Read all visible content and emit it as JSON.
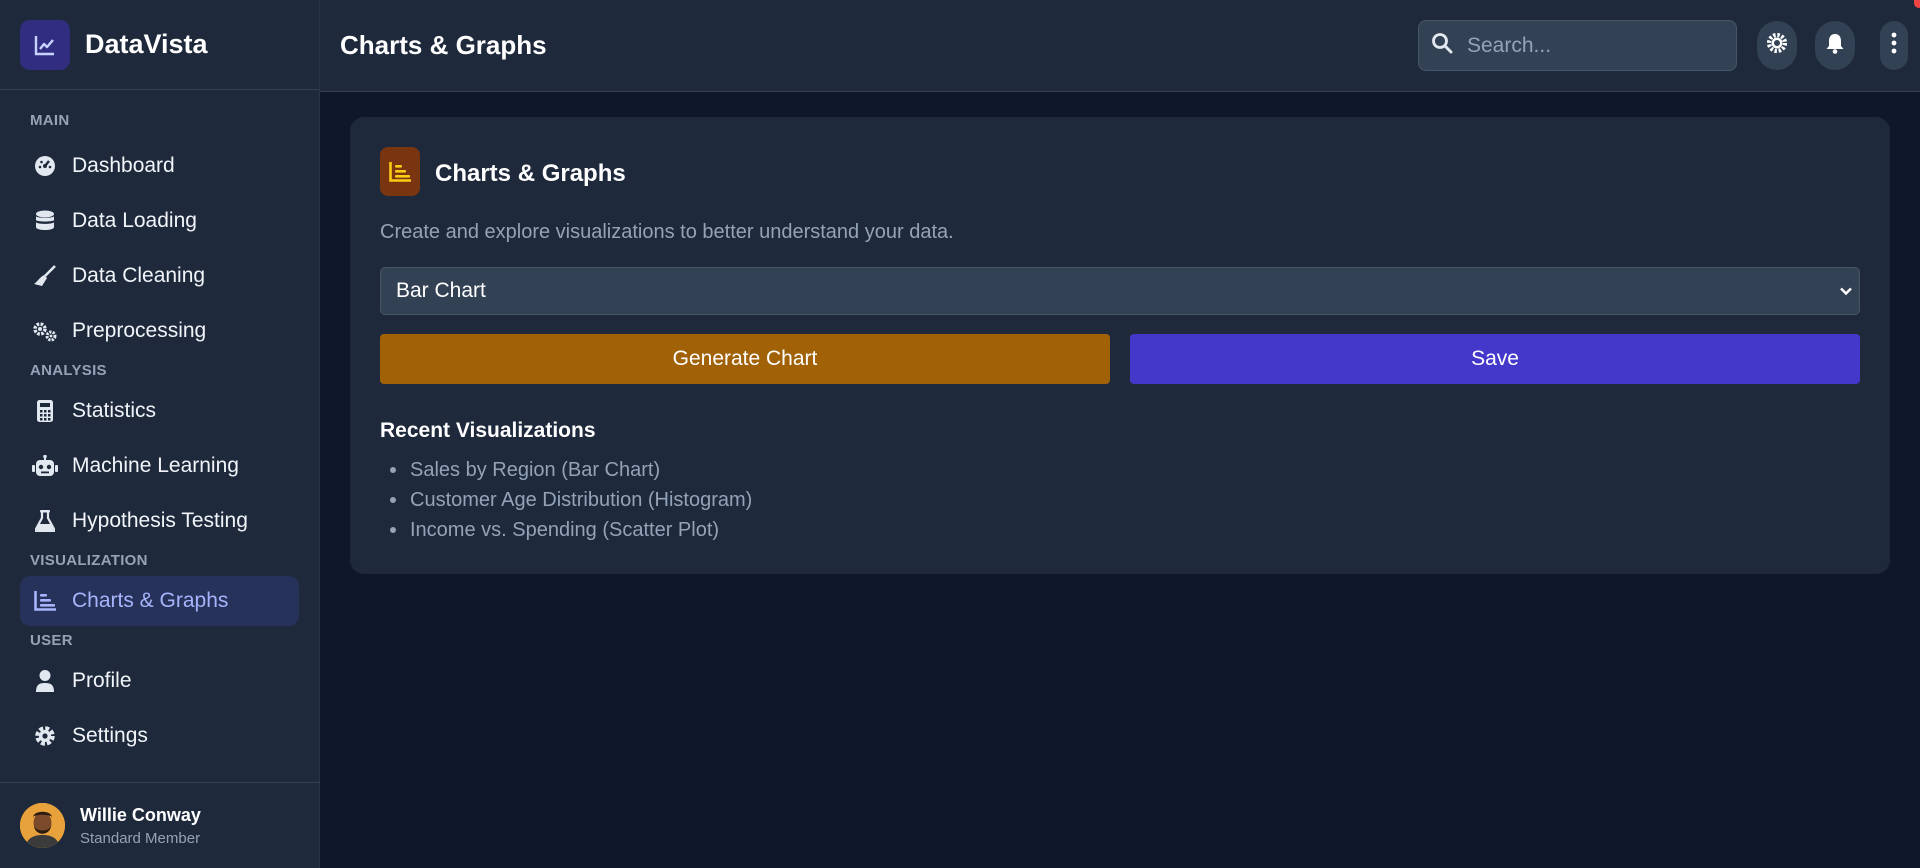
{
  "brand": {
    "name": "DataVista",
    "icon": "chart-line-icon"
  },
  "sidebar": {
    "sections": {
      "main": "MAIN",
      "analysis": "ANALYSIS",
      "visualization": "VISUALIZATION",
      "user": "USER"
    },
    "items": [
      {
        "label": "Dashboard",
        "icon": "gauge-icon"
      },
      {
        "label": "Data Loading",
        "icon": "database-icon"
      },
      {
        "label": "Data Cleaning",
        "icon": "broom-icon"
      },
      {
        "label": "Preprocessing",
        "icon": "gears-icon"
      },
      {
        "label": "Statistics",
        "icon": "calculator-icon"
      },
      {
        "label": "Machine Learning",
        "icon": "robot-icon"
      },
      {
        "label": "Hypothesis Testing",
        "icon": "flask-icon"
      },
      {
        "label": "Charts & Graphs",
        "icon": "bar-chart-icon",
        "active": true
      },
      {
        "label": "Profile",
        "icon": "user-icon"
      },
      {
        "label": "Settings",
        "icon": "gear-icon"
      }
    ]
  },
  "user": {
    "name": "Willie Conway",
    "role": "Standard Member"
  },
  "header": {
    "title": "Charts & Graphs",
    "search_placeholder": "Search...",
    "icons": [
      "search-icon",
      "sun-icon",
      "bell-icon",
      "more-vertical-icon"
    ]
  },
  "card": {
    "title": "Charts & Graphs",
    "description": "Create and explore visualizations to better understand your data.",
    "chart_type_selected": "Bar Chart",
    "generate_label": "Generate Chart",
    "save_label": "Save",
    "recent_title": "Recent Visualizations",
    "recent": [
      "Sales by Region (Bar Chart)",
      "Customer Age Distribution (Histogram)",
      "Income vs. Spending (Scatter Plot)"
    ]
  },
  "colors": {
    "accent": "#4338ca",
    "generate": "#a16207",
    "background": "#0f172a",
    "panel": "#1e293b",
    "active_text": "#a5b4fc"
  }
}
